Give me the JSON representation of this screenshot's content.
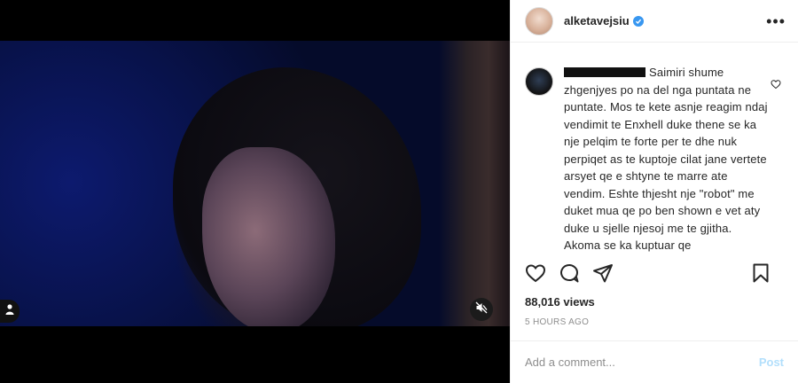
{
  "media": {
    "user_tag_icon": "person-icon",
    "mute_icon": "speaker-muted-icon"
  },
  "header": {
    "username": "alketavejsiu",
    "verified_icon": "verified-badge-icon",
    "more_icon": "more-options-icon",
    "more_glyph": "•••"
  },
  "comment": {
    "redacted_username": true,
    "text": "Saimiri shume zhgenjyes po na del nga puntata ne puntate. Mos te kete asnje reagim ndaj vendimit te Enxhell duke thene se ka nje pelqim te forte per te dhe nuk perpiqet as te kuptoje cilat jane vertete arsyet qe e shtyne te marre ate vendim. Eshte thjesht nje \"robot\" me duket mua qe po ben shown e vet aty duke u sjelle njesoj me te gjitha. Akoma se ka kuptuar qe",
    "like_icon": "heart-outline-icon"
  },
  "actions": {
    "like_icon": "heart-outline-icon",
    "comment_icon": "comment-bubble-icon",
    "share_icon": "paper-plane-icon",
    "save_icon": "bookmark-icon"
  },
  "stats": {
    "views": "88,016 views",
    "timestamp": "5 HOURS AGO"
  },
  "add_comment": {
    "placeholder": "Add a comment...",
    "post_label": "Post"
  },
  "colors": {
    "accent": "#3897f0",
    "post_disabled": "#b2dffc",
    "muted_text": "#8e8e8e"
  }
}
